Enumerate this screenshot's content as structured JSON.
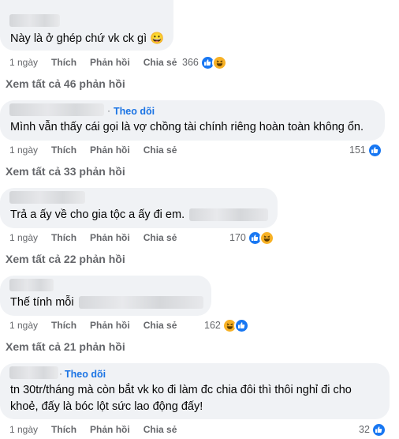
{
  "colors": {
    "bubble": "#f0f2f5",
    "link": "#1b74e4",
    "meta": "#65676b",
    "like": "#1877f2",
    "haha": "#f7b125"
  },
  "actions": {
    "time": "1 ngày",
    "like": "Thích",
    "reply": "Phản hồi",
    "share": "Chia sẻ"
  },
  "comments": [
    {
      "text": "Này là ở ghép chứ vk ck gì",
      "emoji": "😀",
      "reaction_count": "366",
      "reactions": [
        "like-icon",
        "haha-icon"
      ],
      "view_replies": "Xem tất cả 46 phản hồi"
    },
    {
      "follow": "Theo dõi",
      "text": "Mình vẫn thấy cái gọi là vợ chồng tài chính riêng hoàn toàn không ổn.",
      "reaction_count": "151",
      "reactions": [
        "like-icon"
      ],
      "view_replies": "Xem tất cả 33 phản hồi"
    },
    {
      "text": "Trả a ấy về cho gia tộc a ấy đi em.",
      "reaction_count": "170",
      "reactions": [
        "like-icon",
        "haha-icon"
      ],
      "view_replies": "Xem tất cả 22 phản hồi"
    },
    {
      "text": "Thế tính mỗi",
      "reaction_count": "162",
      "reactions": [
        "haha-icon",
        "like-icon"
      ],
      "view_replies": "Xem tất cả 21 phản hồi"
    },
    {
      "follow": "Theo dõi",
      "text_line1": "tn 30tr/tháng mà còn bắt vk ko đi làm đc chia đôi thì thôi nghỉ đi cho",
      "text_line2": "khoẻ, đấy là bóc lột sức lao động đấy!",
      "reaction_count": "32",
      "reactions": [
        "like-icon"
      ]
    }
  ]
}
